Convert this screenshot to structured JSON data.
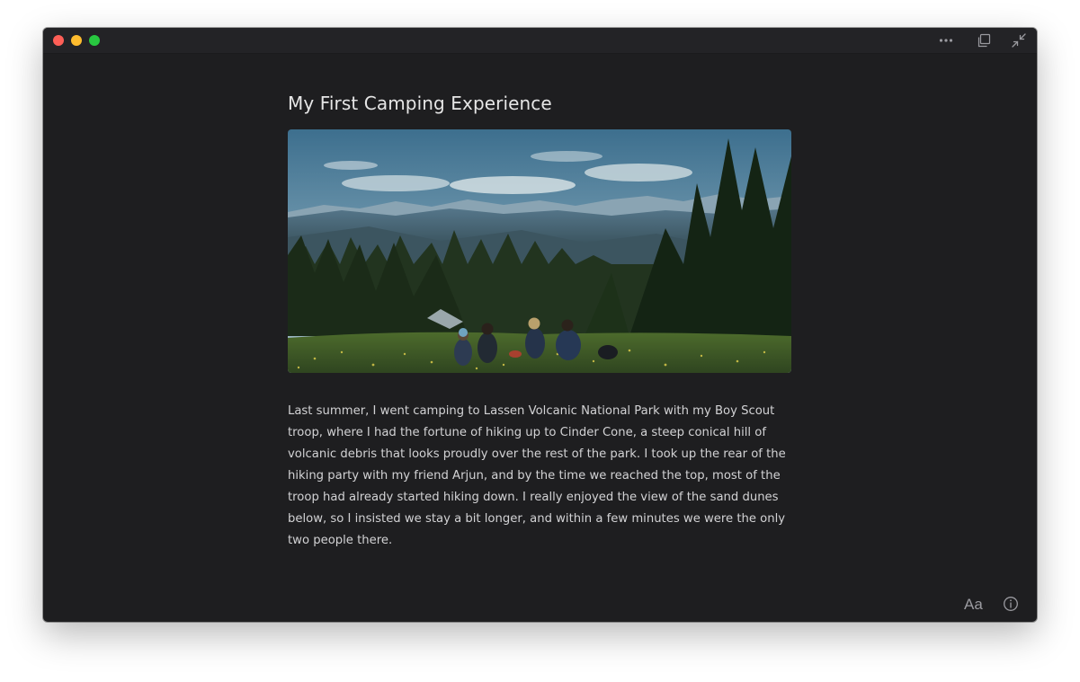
{
  "window": {
    "traffic_lights": {
      "close_color": "#fe5f57",
      "minimize_color": "#febc2e",
      "maximize_color": "#28c840"
    },
    "toolbar_icons": [
      "more-icon",
      "duplicate-icon",
      "collapse-icon"
    ]
  },
  "article": {
    "title": "My First Camping Experience",
    "image_icon": "camping-photo",
    "body": "Last summer, I went camping to Lassen Volcanic National Park with my Boy Scout troop, where I had the fortune of hiking up to Cinder Cone, a steep conical hill of volcanic debris that looks proudly over the rest of the park. I took up the rear of the hiking party with my friend Arjun, and by the time we reached the top, most of the troop had already started hiking down. I really enjoyed the view of the sand dunes below, so I insisted we stay a bit longer, and within a few minutes we were the only two people there."
  },
  "footer": {
    "font_label": "Aa",
    "info_icon": "info-icon"
  }
}
